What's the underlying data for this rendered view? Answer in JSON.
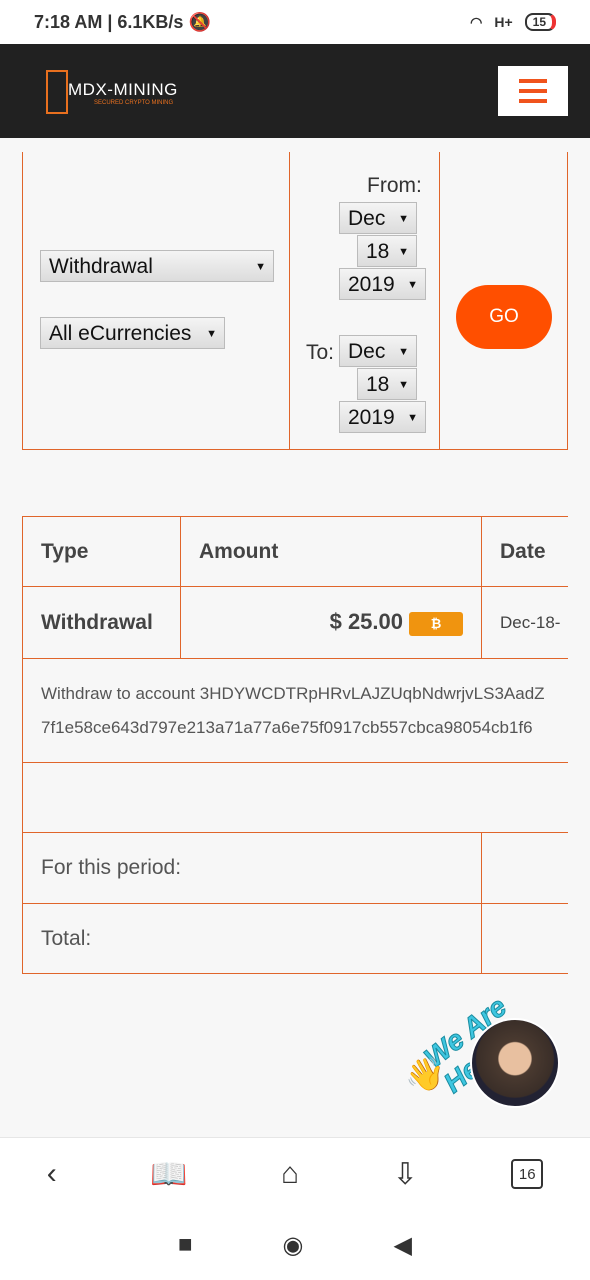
{
  "status_bar": {
    "time": "7:18 AM",
    "speed": "6.1KB/s",
    "network": "H+",
    "battery": "15"
  },
  "header": {
    "logo_title": "MDX-MINING",
    "logo_subtitle": "SECURED CRYPTO MINING",
    "menu_icon": "hamburger-icon"
  },
  "filters": {
    "type": "Withdrawal",
    "currency": "All eCurrencies",
    "from_label": "From:",
    "to_label": "To:",
    "from": {
      "month": "Dec",
      "day": "18",
      "year": "2019"
    },
    "to": {
      "month": "Dec",
      "day": "18",
      "year": "2019"
    },
    "go_label": "GO"
  },
  "results": {
    "headers": [
      "Type",
      "Amount",
      "Date"
    ],
    "rows": [
      {
        "type": "Withdrawal",
        "amount": "$ 25.00",
        "currency_icon": "bitcoin-icon",
        "date": "Dec-18-",
        "description_line1": "Withdraw to account 3HDYWCDTRpHRvLAJZUqbNdwrjvLS3AadZ",
        "description_line2": "7f1e58ce643d797e213a71a77a6e75f0917cb557cbca98054cb1f6"
      }
    ],
    "period_label": "For this period:",
    "total_label": "Total:"
  },
  "chat": {
    "label": "We Are Here!"
  },
  "colors": {
    "accent": "#ff4f00",
    "border": "#e0652a",
    "header_bg": "#212121",
    "bitcoin": "#f0940f"
  }
}
